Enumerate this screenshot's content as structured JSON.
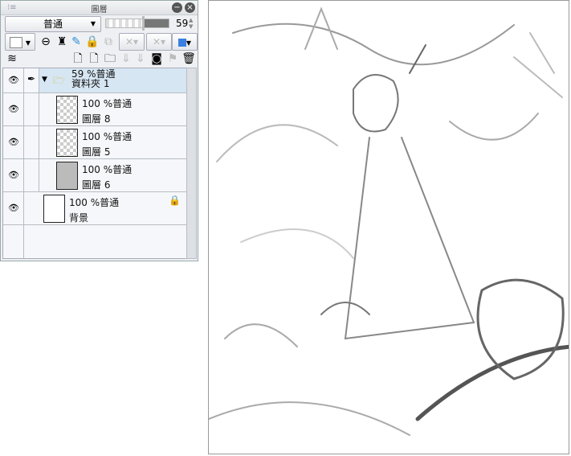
{
  "panel": {
    "title": "圖層",
    "blend_mode": "普通",
    "opacity_value": "59",
    "opacity_fraction": 0.59
  },
  "layers": [
    {
      "opacity_blend": "59 %普通",
      "name": "資料夾 1",
      "type": "folder",
      "selected": true
    },
    {
      "opacity_blend": "100 %普通",
      "name": "圖層 8"
    },
    {
      "opacity_blend": "100 %普通",
      "name": "圖層 5"
    },
    {
      "opacity_blend": "100 %普通",
      "name": "圖層 6"
    },
    {
      "opacity_blend": "100 %普通",
      "name": "背景",
      "locked": true
    }
  ]
}
